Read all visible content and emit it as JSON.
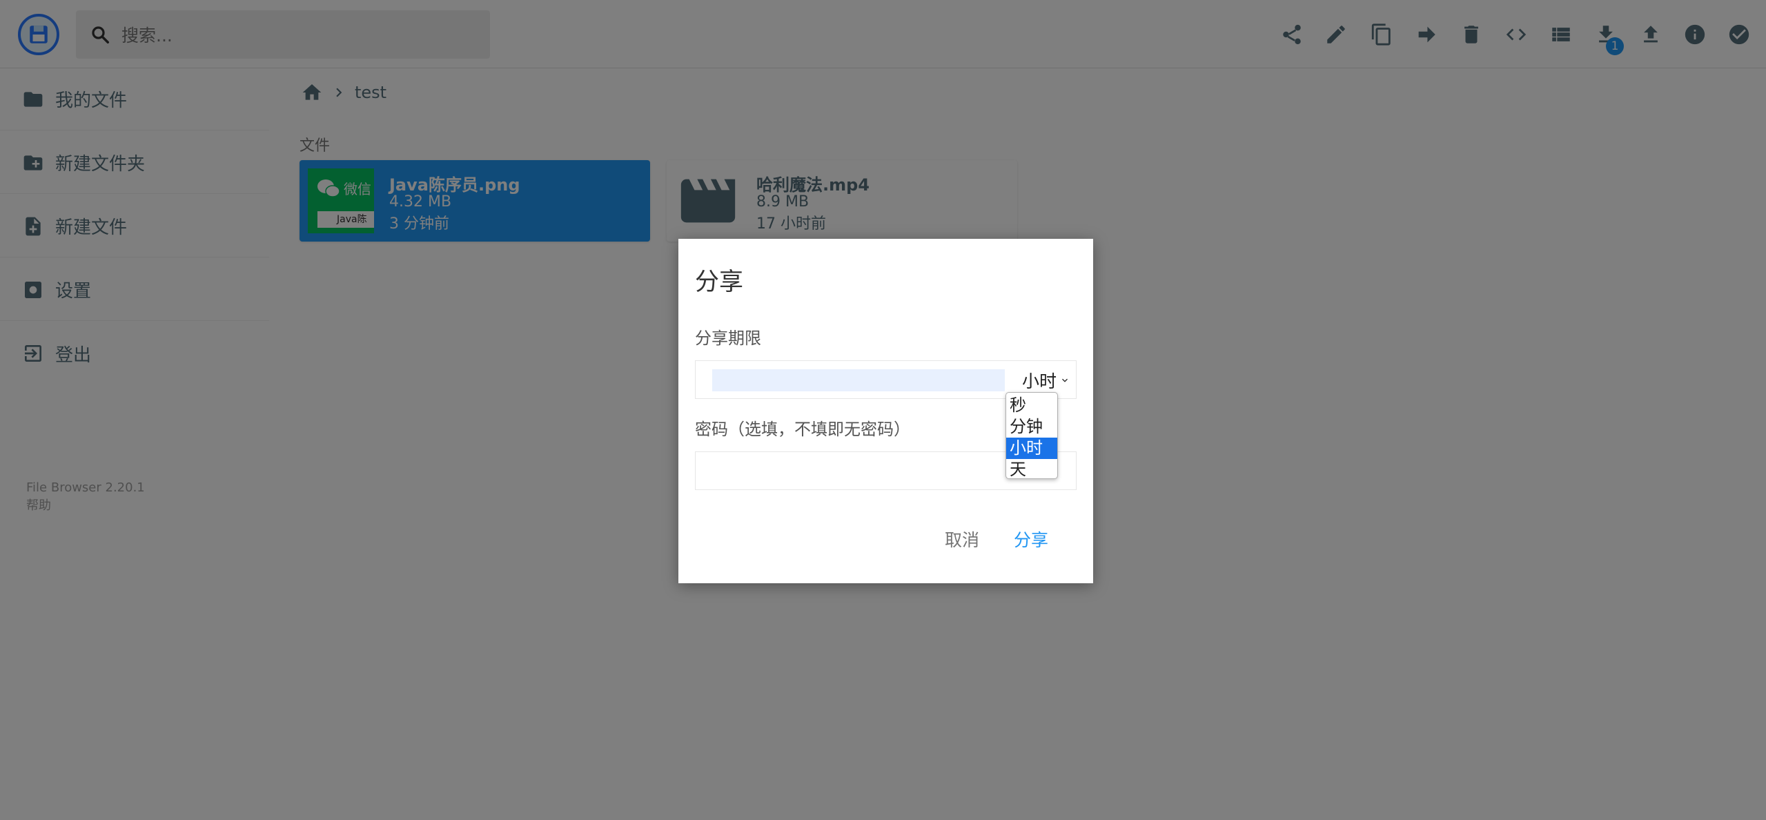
{
  "header": {
    "search_placeholder": "搜索..."
  },
  "toolbar": {
    "icons": [
      "share-icon",
      "edit-icon",
      "copy-icon",
      "move-icon",
      "delete-icon",
      "code-icon",
      "list-view-icon",
      "download-icon",
      "upload-icon",
      "info-icon",
      "check-circle-icon"
    ],
    "download_badge": "1"
  },
  "sidebar": {
    "items": [
      {
        "label": "我的文件",
        "icon": "folder-icon"
      },
      {
        "label": "新建文件夹",
        "icon": "create-folder-icon"
      },
      {
        "label": "新建文件",
        "icon": "new-file-icon"
      },
      {
        "label": "设置",
        "icon": "settings-icon"
      },
      {
        "label": "登出",
        "icon": "logout-icon"
      }
    ],
    "version": "File Browser 2.20.1",
    "help": "帮助"
  },
  "breadcrumb": {
    "current": "test"
  },
  "files_section": {
    "title": "文件",
    "items": [
      {
        "name": "Java陈序员.png",
        "size": "4.32 MB",
        "modified": "3 分钟前",
        "selected": true
      },
      {
        "name": "哈利魔法.mp4",
        "size": "8.9 MB",
        "modified": "17 小时前",
        "selected": false
      }
    ]
  },
  "thumbnail": {
    "label_top": "微信",
    "label_bottom": "Java陈"
  },
  "dialog": {
    "title": "分享",
    "expiry_label": "分享期限",
    "expiry_value": "",
    "unit_selected": "小时",
    "unit_options": [
      "秒",
      "分钟",
      "小时",
      "天"
    ],
    "password_label": "密码（选填，不填即无密码）",
    "password_value": "",
    "cancel_label": "取消",
    "share_label": "分享"
  },
  "colors": {
    "accent": "#2196f3",
    "selected_option": "#1a73e8",
    "icon": "#546e7a"
  }
}
